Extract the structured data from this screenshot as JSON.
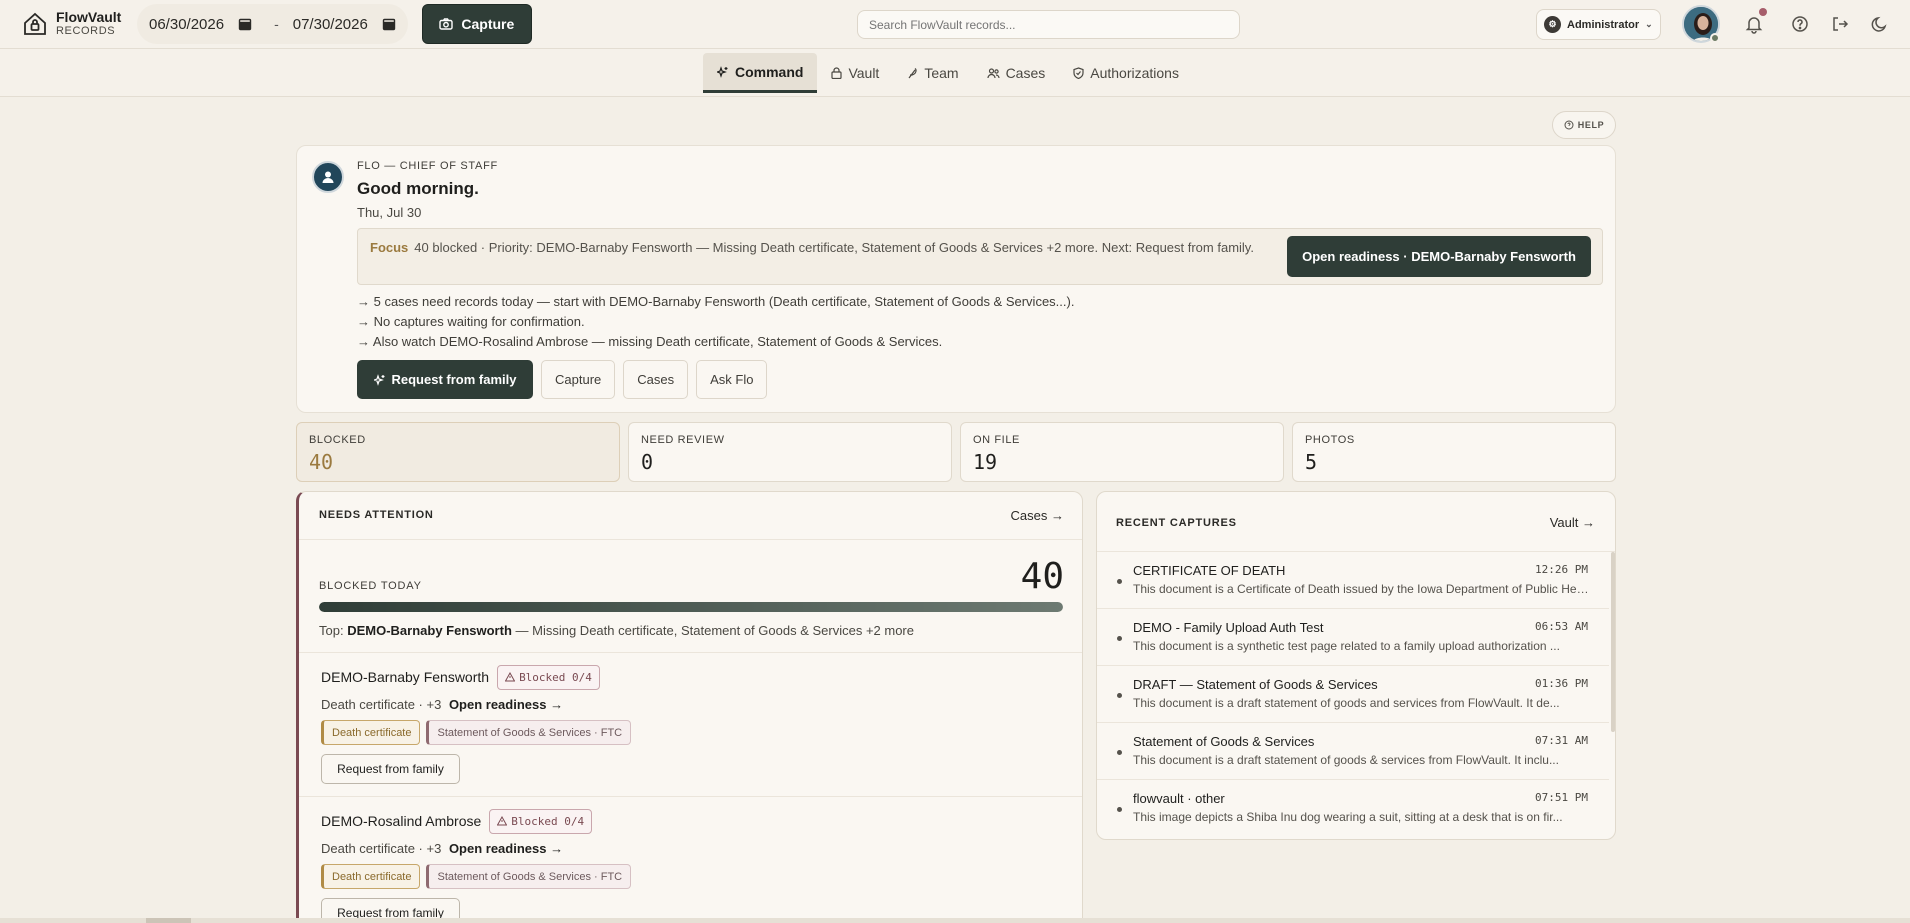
{
  "brand": {
    "name": "FlowVault",
    "sub": "RECORDS"
  },
  "header": {
    "date_from": "06/30/2026",
    "date_sep": "-",
    "date_to": "07/30/2026",
    "capture_label": "Capture",
    "search_placeholder": "Search FlowVault records...",
    "role": "Administrator"
  },
  "tabs": [
    {
      "label": "Command",
      "active": true
    },
    {
      "label": "Vault"
    },
    {
      "label": "Team"
    },
    {
      "label": "Cases"
    },
    {
      "label": "Authorizations"
    }
  ],
  "help_label": "HELP",
  "flo": {
    "eyebrow": "FLO — CHIEF OF STAFF",
    "greeting": "Good morning.",
    "date": "Thu, Jul 30",
    "focus_label": "Focus",
    "focus_text": "40 blocked · Priority: DEMO-Barnaby Fensworth — Missing Death certificate, Statement of Goods & Services +2 more. Next: Request from family.",
    "focus_button": "Open readiness · DEMO-Barnaby Fensworth",
    "lines": [
      "→ 5 cases need records today — start with DEMO-Barnaby Fensworth (Death certificate, Statement of Goods & Services...).",
      "→ No captures waiting for confirmation.",
      "→ Also watch DEMO-Rosalind Ambrose — missing Death certificate, Statement of Goods & Services."
    ],
    "actions": {
      "primary": "Request from family",
      "capture": "Capture",
      "cases": "Cases",
      "ask": "Ask Flo"
    }
  },
  "stats": [
    {
      "label": "BLOCKED",
      "value": "40"
    },
    {
      "label": "NEED REVIEW",
      "value": "0"
    },
    {
      "label": "ON FILE",
      "value": "19"
    },
    {
      "label": "PHOTOS",
      "value": "5"
    }
  ],
  "attention": {
    "title": "NEEDS ATTENTION",
    "link": "Cases →",
    "blocked_label": "BLOCKED TODAY",
    "blocked_value": "40",
    "blocked_fill": 1.0,
    "top_prefix": "Top:",
    "top_name": "DEMO-Barnaby Fensworth",
    "top_rest": "— Missing Death certificate, Statement of Goods & Services +2 more",
    "cases": [
      {
        "name": "DEMO-Barnaby Fensworth",
        "badge": "Blocked 0/4",
        "sub": "Death certificate · +3",
        "link": "Open readiness →",
        "chips": [
          "Death certificate",
          "Statement of Goods & Services · FTC"
        ],
        "button": "Request from family"
      },
      {
        "name": "DEMO-Rosalind Ambrose",
        "badge": "Blocked 0/4",
        "sub": "Death certificate · +3",
        "link": "Open readiness →",
        "chips": [
          "Death certificate",
          "Statement of Goods & Services · FTC"
        ],
        "button": "Request from family"
      }
    ]
  },
  "recent": {
    "title": "RECENT CAPTURES",
    "link": "Vault →",
    "items": [
      {
        "title": "CERTIFICATE OF DEATH",
        "time": "12:26 PM",
        "desc": "This document is a Certificate of Death issued by the Iowa Department of Public Health..."
      },
      {
        "title": "DEMO - Family Upload Auth Test",
        "time": "06:53 AM",
        "desc": "This document is a synthetic test page related to a family upload authorization ..."
      },
      {
        "title": "DRAFT — Statement of Goods & Services",
        "time": "01:36 PM",
        "desc": "This document is a draft statement of goods and services from FlowVault. It de..."
      },
      {
        "title": "Statement of Goods & Services",
        "time": "07:31 AM",
        "desc": "This document is a draft statement of goods & services from FlowVault. It inclu..."
      },
      {
        "title": "flowvault · other",
        "time": "07:51 PM",
        "desc": "This image depicts a Shiba Inu dog wearing a suit, sitting at a desk that is on fir..."
      }
    ]
  }
}
